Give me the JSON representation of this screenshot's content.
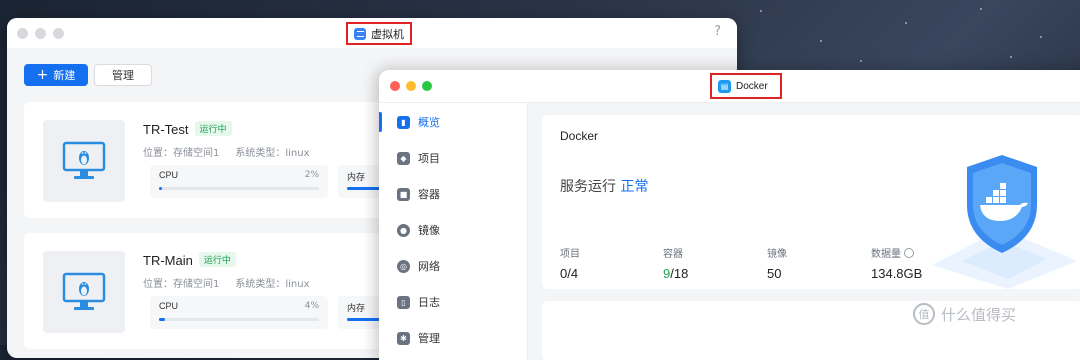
{
  "vm_window": {
    "title": "虚拟机",
    "help": "?",
    "new_button": "新建",
    "new_icon": "plus-icon",
    "manage_button": "管理",
    "cards": [
      {
        "name": "TR-Test",
        "status": "运行中",
        "location": "位置：存储空间1",
        "os": "系统类型：linux",
        "cpu_label": "CPU",
        "cpu_value": "2%",
        "cpu_fraction": 0.02,
        "mem_label": "内存",
        "mem_fraction": 0.4
      },
      {
        "name": "TR-Main",
        "status": "运行中",
        "location": "位置：存储空间1",
        "os": "系统类型：linux",
        "cpu_label": "CPU",
        "cpu_value": "4%",
        "cpu_fraction": 0.04,
        "mem_label": "内存",
        "mem_fraction": 0.4
      }
    ]
  },
  "docker_window": {
    "title": "Docker",
    "sidebar": [
      {
        "label": "概览",
        "icon": "chart-icon",
        "active": true
      },
      {
        "label": "项目",
        "icon": "cubes-icon",
        "active": false
      },
      {
        "label": "容器",
        "icon": "box-icon",
        "active": false
      },
      {
        "label": "镜像",
        "icon": "disc-icon",
        "active": false
      },
      {
        "label": "网络",
        "icon": "globe-icon",
        "active": false
      },
      {
        "label": "日志",
        "icon": "book-icon",
        "active": false
      },
      {
        "label": "管理",
        "icon": "gear-icon",
        "active": false
      }
    ],
    "overview": {
      "title": "Docker",
      "status_prefix": "服务运行",
      "status_value": "正常",
      "stats": {
        "projects": {
          "label": "项目",
          "value": "0/4"
        },
        "containers": {
          "label": "容器",
          "running": "9",
          "total": "/18"
        },
        "images": {
          "label": "镜像",
          "value": "50"
        },
        "data": {
          "label": "数据量",
          "value": "134.8GB"
        }
      }
    }
  },
  "watermark": {
    "text": "什么值得买",
    "logo_text": "值"
  },
  "colors": {
    "accent": "#1570ef",
    "success": "#22a34a",
    "highlight_border": "#e02424"
  }
}
